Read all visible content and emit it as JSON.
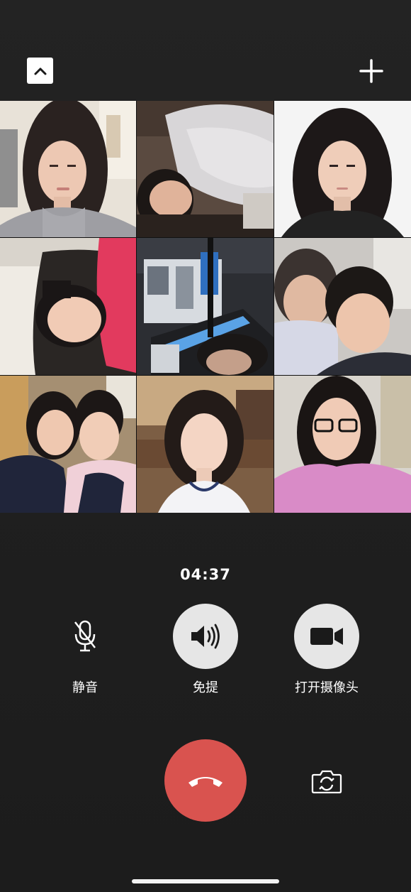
{
  "call": {
    "timer": "04:37"
  },
  "header": {
    "collapse_icon": "chevron-up-icon",
    "add_icon": "plus-icon"
  },
  "participants": [
    {
      "id": "p1",
      "bg": "#e9e4dc"
    },
    {
      "id": "p2",
      "bg": "#5c4e44"
    },
    {
      "id": "p3",
      "bg": "#f3f3f3"
    },
    {
      "id": "p4",
      "bg": "#f1eee8"
    },
    {
      "id": "p5",
      "bg": "#2d2f34"
    },
    {
      "id": "p6",
      "bg": "#c9c6c2"
    },
    {
      "id": "p7",
      "bg": "#9a8a73"
    },
    {
      "id": "p8",
      "bg": "#8c6b4f"
    },
    {
      "id": "p9",
      "bg": "#d6d2cc"
    }
  ],
  "controls": {
    "mute": {
      "label": "静音",
      "icon": "mic-muted-icon",
      "active": false
    },
    "speaker": {
      "label": "免提",
      "icon": "speaker-icon",
      "active": true
    },
    "camera": {
      "label": "打开摄像头",
      "icon": "video-camera-icon",
      "active": true
    }
  },
  "actions": {
    "hangup_icon": "phone-hangup-icon",
    "hangup_color": "#d9534f",
    "flip_icon": "camera-flip-icon"
  }
}
